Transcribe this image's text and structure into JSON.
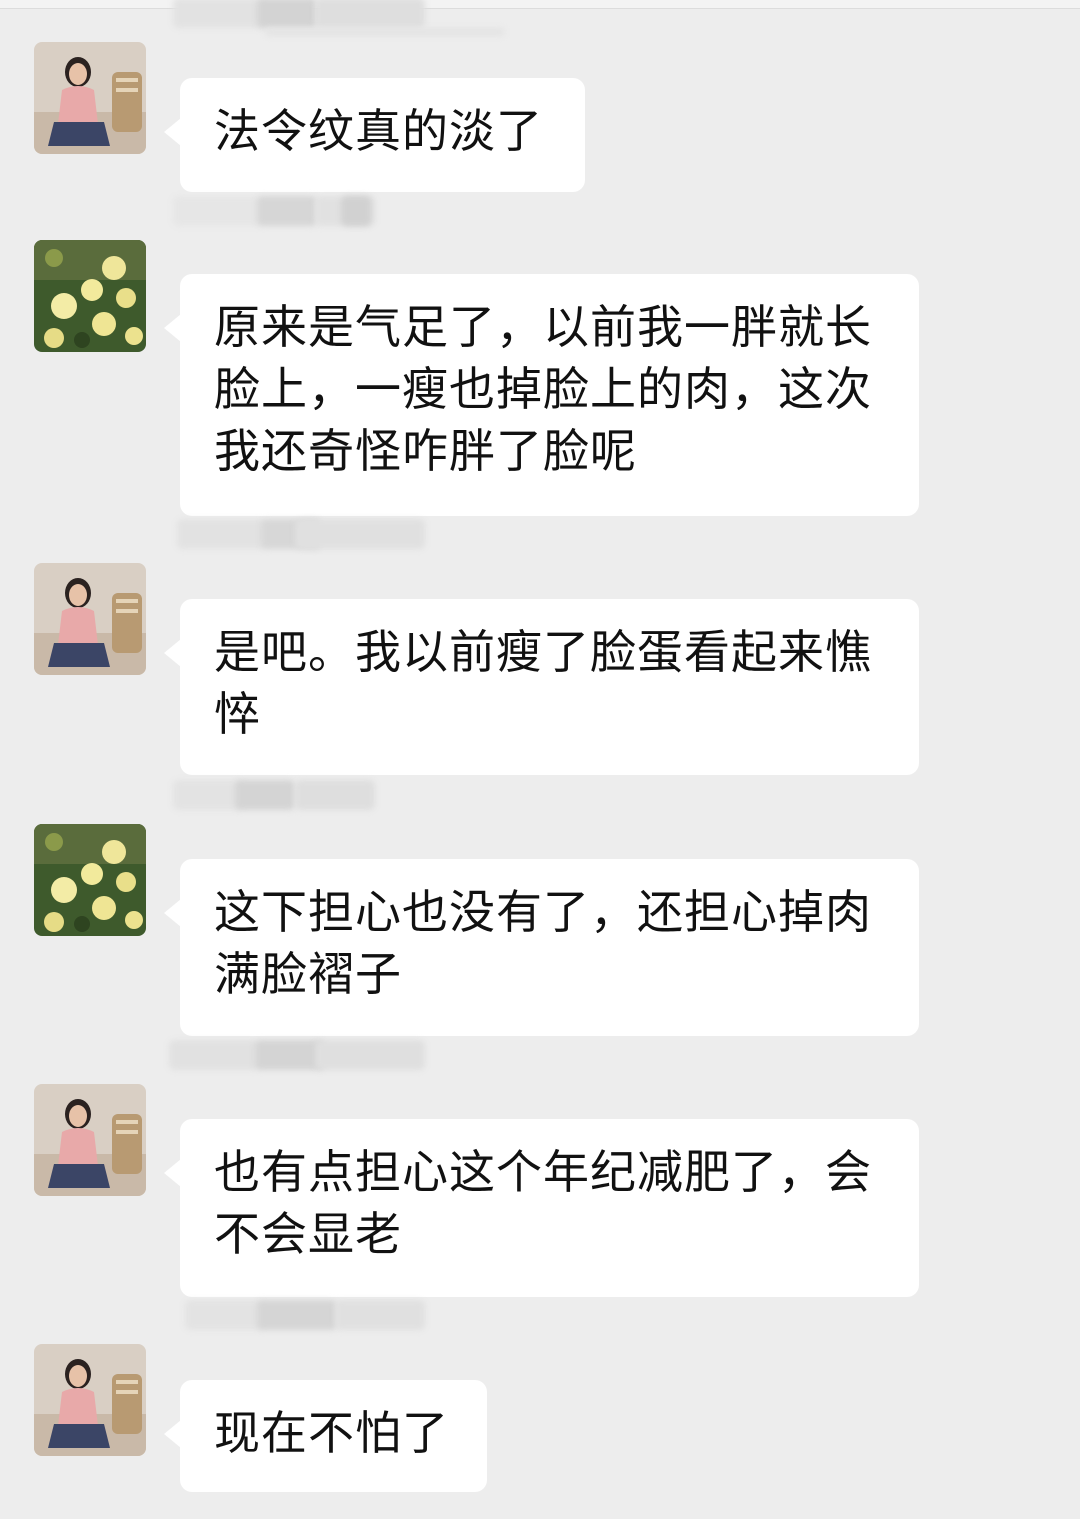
{
  "chat": {
    "messages": [
      {
        "sender": "",
        "avatar": "woman-photo-avatar",
        "text": "法令纹真的淡了"
      },
      {
        "sender": "",
        "avatar": "yellow-roses-avatar",
        "text": "原来是气足了，以前我一胖就长脸上，一瘦也掉脸上的肉，这次我还奇怪咋胖了脸呢"
      },
      {
        "sender": "",
        "avatar": "woman-photo-avatar",
        "text": "是吧。我以前瘦了脸蛋看起来憔悴"
      },
      {
        "sender": "",
        "avatar": "yellow-roses-avatar",
        "text": "这下担心也没有了，还担心掉肉满脸褶子"
      },
      {
        "sender": "",
        "avatar": "woman-photo-avatar",
        "text": "也有点担心这个年纪减肥了，会不会显老"
      },
      {
        "sender": "",
        "avatar": "woman-photo-avatar",
        "text": "现在不怕了"
      }
    ]
  },
  "colors": {
    "background": "#ededed",
    "bubble": "#ffffff",
    "text": "#111111"
  }
}
